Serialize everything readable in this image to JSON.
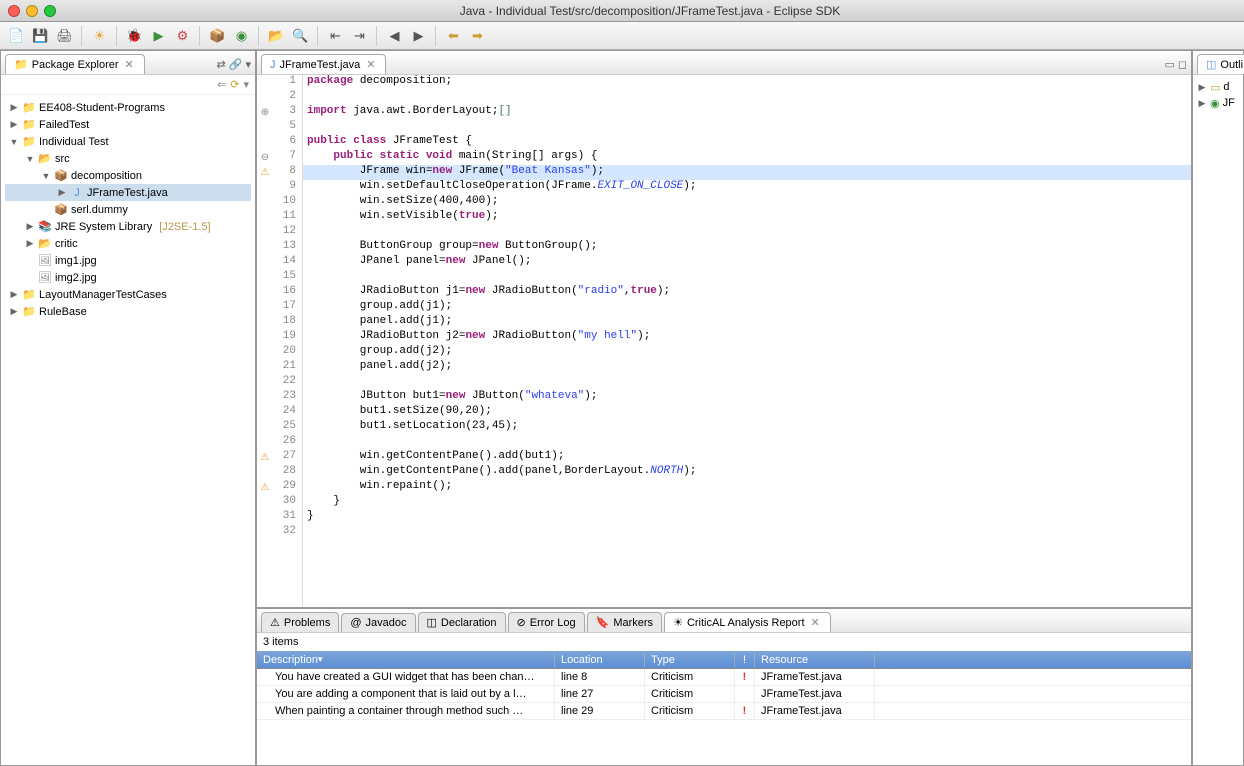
{
  "window": {
    "title": "Java - Individual Test/src/decomposition/JFrameTest.java - Eclipse SDK"
  },
  "explorer": {
    "title": "Package Explorer",
    "projects": [
      {
        "name": "EE408-Student-Programs",
        "icon": "proj",
        "indent": 0,
        "arrow": "▶"
      },
      {
        "name": "FailedTest",
        "icon": "proj",
        "indent": 0,
        "arrow": "▶"
      },
      {
        "name": "Individual Test",
        "icon": "proj",
        "indent": 0,
        "arrow": "▼"
      },
      {
        "name": "src",
        "icon": "fold",
        "indent": 1,
        "arrow": "▼"
      },
      {
        "name": "decomposition",
        "icon": "pkg",
        "indent": 2,
        "arrow": "▼"
      },
      {
        "name": "JFrameTest.java",
        "icon": "java",
        "indent": 3,
        "arrow": "▶",
        "sel": true
      },
      {
        "name": "serl.dummy",
        "icon": "pkg",
        "indent": 2,
        "arrow": ""
      },
      {
        "name": "JRE System Library",
        "suffix": "[J2SE-1.5]",
        "icon": "jar",
        "indent": 1,
        "arrow": "▶"
      },
      {
        "name": "critic",
        "icon": "fold",
        "indent": 1,
        "arrow": "▶"
      },
      {
        "name": "img1.jpg",
        "icon": "img",
        "indent": 1,
        "arrow": ""
      },
      {
        "name": "img2.jpg",
        "icon": "img",
        "indent": 1,
        "arrow": ""
      },
      {
        "name": "LayoutManagerTestCases",
        "icon": "proj",
        "indent": 0,
        "arrow": "▶"
      },
      {
        "name": "RuleBase",
        "icon": "proj",
        "indent": 0,
        "arrow": "▶"
      }
    ]
  },
  "editor": {
    "tab": "JFrameTest.java",
    "hl_line": 8,
    "markers": {
      "3": "+",
      "7": "-",
      "8": "w",
      "27": "w",
      "29": "w"
    },
    "lines": [
      {
        "n": 1,
        "t": [
          {
            "c": "kw",
            "s": "package"
          },
          {
            "s": " decomposition;"
          }
        ]
      },
      {
        "n": 2,
        "t": []
      },
      {
        "n": 3,
        "t": [
          {
            "c": "kw",
            "s": "import"
          },
          {
            "s": " java.awt.BorderLayout;"
          },
          {
            "c": "com",
            "s": "[]"
          }
        ]
      },
      {
        "n": 5,
        "t": []
      },
      {
        "n": 6,
        "t": [
          {
            "c": "kw",
            "s": "public class"
          },
          {
            "s": " JFrameTest {"
          }
        ]
      },
      {
        "n": 7,
        "t": [
          {
            "s": "    "
          },
          {
            "c": "kw",
            "s": "public static void"
          },
          {
            "s": " main(String[] args) {"
          }
        ]
      },
      {
        "n": 8,
        "t": [
          {
            "s": "        JFrame win="
          },
          {
            "c": "kw",
            "s": "new"
          },
          {
            "s": " JFrame("
          },
          {
            "c": "str",
            "s": "\"Beat Kansas\""
          },
          {
            "s": ");"
          }
        ]
      },
      {
        "n": 9,
        "t": [
          {
            "s": "        win.setDefaultCloseOperation(JFrame."
          },
          {
            "c": "const",
            "s": "EXIT_ON_CLOSE"
          },
          {
            "s": ");"
          }
        ]
      },
      {
        "n": 10,
        "t": [
          {
            "s": "        win.setSize(400,400);"
          }
        ]
      },
      {
        "n": 11,
        "t": [
          {
            "s": "        win.setVisible("
          },
          {
            "c": "kw",
            "s": "true"
          },
          {
            "s": ");"
          }
        ]
      },
      {
        "n": 12,
        "t": []
      },
      {
        "n": 13,
        "t": [
          {
            "s": "        ButtonGroup group="
          },
          {
            "c": "kw",
            "s": "new"
          },
          {
            "s": " ButtonGroup();"
          }
        ]
      },
      {
        "n": 14,
        "t": [
          {
            "s": "        JPanel panel="
          },
          {
            "c": "kw",
            "s": "new"
          },
          {
            "s": " JPanel();"
          }
        ]
      },
      {
        "n": 15,
        "t": []
      },
      {
        "n": 16,
        "t": [
          {
            "s": "        JRadioButton j1="
          },
          {
            "c": "kw",
            "s": "new"
          },
          {
            "s": " JRadioButton("
          },
          {
            "c": "str",
            "s": "\"radio\""
          },
          {
            "s": ","
          },
          {
            "c": "kw",
            "s": "true"
          },
          {
            "s": ");"
          }
        ]
      },
      {
        "n": 17,
        "t": [
          {
            "s": "        group.add(j1);"
          }
        ]
      },
      {
        "n": 18,
        "t": [
          {
            "s": "        panel.add(j1);"
          }
        ]
      },
      {
        "n": 19,
        "t": [
          {
            "s": "        JRadioButton j2="
          },
          {
            "c": "kw",
            "s": "new"
          },
          {
            "s": " JRadioButton("
          },
          {
            "c": "str",
            "s": "\"my hell\""
          },
          {
            "s": ");"
          }
        ]
      },
      {
        "n": 20,
        "t": [
          {
            "s": "        group.add(j2);"
          }
        ]
      },
      {
        "n": 21,
        "t": [
          {
            "s": "        panel.add(j2);"
          }
        ]
      },
      {
        "n": 22,
        "t": []
      },
      {
        "n": 23,
        "t": [
          {
            "s": "        JButton but1="
          },
          {
            "c": "kw",
            "s": "new"
          },
          {
            "s": " JButton("
          },
          {
            "c": "str",
            "s": "\"whateva\""
          },
          {
            "s": ");"
          }
        ]
      },
      {
        "n": 24,
        "t": [
          {
            "s": "        but1.setSize(90,20);"
          }
        ]
      },
      {
        "n": 25,
        "t": [
          {
            "s": "        but1.setLocation(23,45);"
          }
        ]
      },
      {
        "n": 26,
        "t": []
      },
      {
        "n": 27,
        "t": [
          {
            "s": "        win.getContentPane().add(but1);"
          }
        ]
      },
      {
        "n": 28,
        "t": [
          {
            "s": "        win.getContentPane().add(panel,BorderLayout."
          },
          {
            "c": "const",
            "s": "NORTH"
          },
          {
            "s": ");"
          }
        ]
      },
      {
        "n": 29,
        "t": [
          {
            "s": "        win.repaint();"
          }
        ]
      },
      {
        "n": 30,
        "t": [
          {
            "s": "    }"
          }
        ]
      },
      {
        "n": 31,
        "t": [
          {
            "s": "}"
          }
        ]
      },
      {
        "n": 32,
        "t": []
      }
    ]
  },
  "bottom": {
    "tabs": [
      "Problems",
      "Javadoc",
      "Declaration",
      "Error Log",
      "Markers",
      "CriticAL Analysis Report"
    ],
    "active": 5,
    "items_label": "3 items",
    "cols": [
      "Description",
      "Location",
      "Type",
      "!",
      "Resource"
    ],
    "rows": [
      {
        "desc": "You have created a GUI widget that has been chan…",
        "loc": "line 8",
        "type": "Criticism",
        "pri": "!",
        "res": "JFrameTest.java"
      },
      {
        "desc": "You are adding a component that is laid out by a l…",
        "loc": "line 27",
        "type": "Criticism",
        "pri": "",
        "res": "JFrameTest.java"
      },
      {
        "desc": "When painting a container through method such …",
        "loc": "line 29",
        "type": "Criticism",
        "pri": "!",
        "res": "JFrameTest.java"
      }
    ]
  },
  "outline": {
    "title": "Outli",
    "rows": [
      "d",
      "JF"
    ]
  }
}
